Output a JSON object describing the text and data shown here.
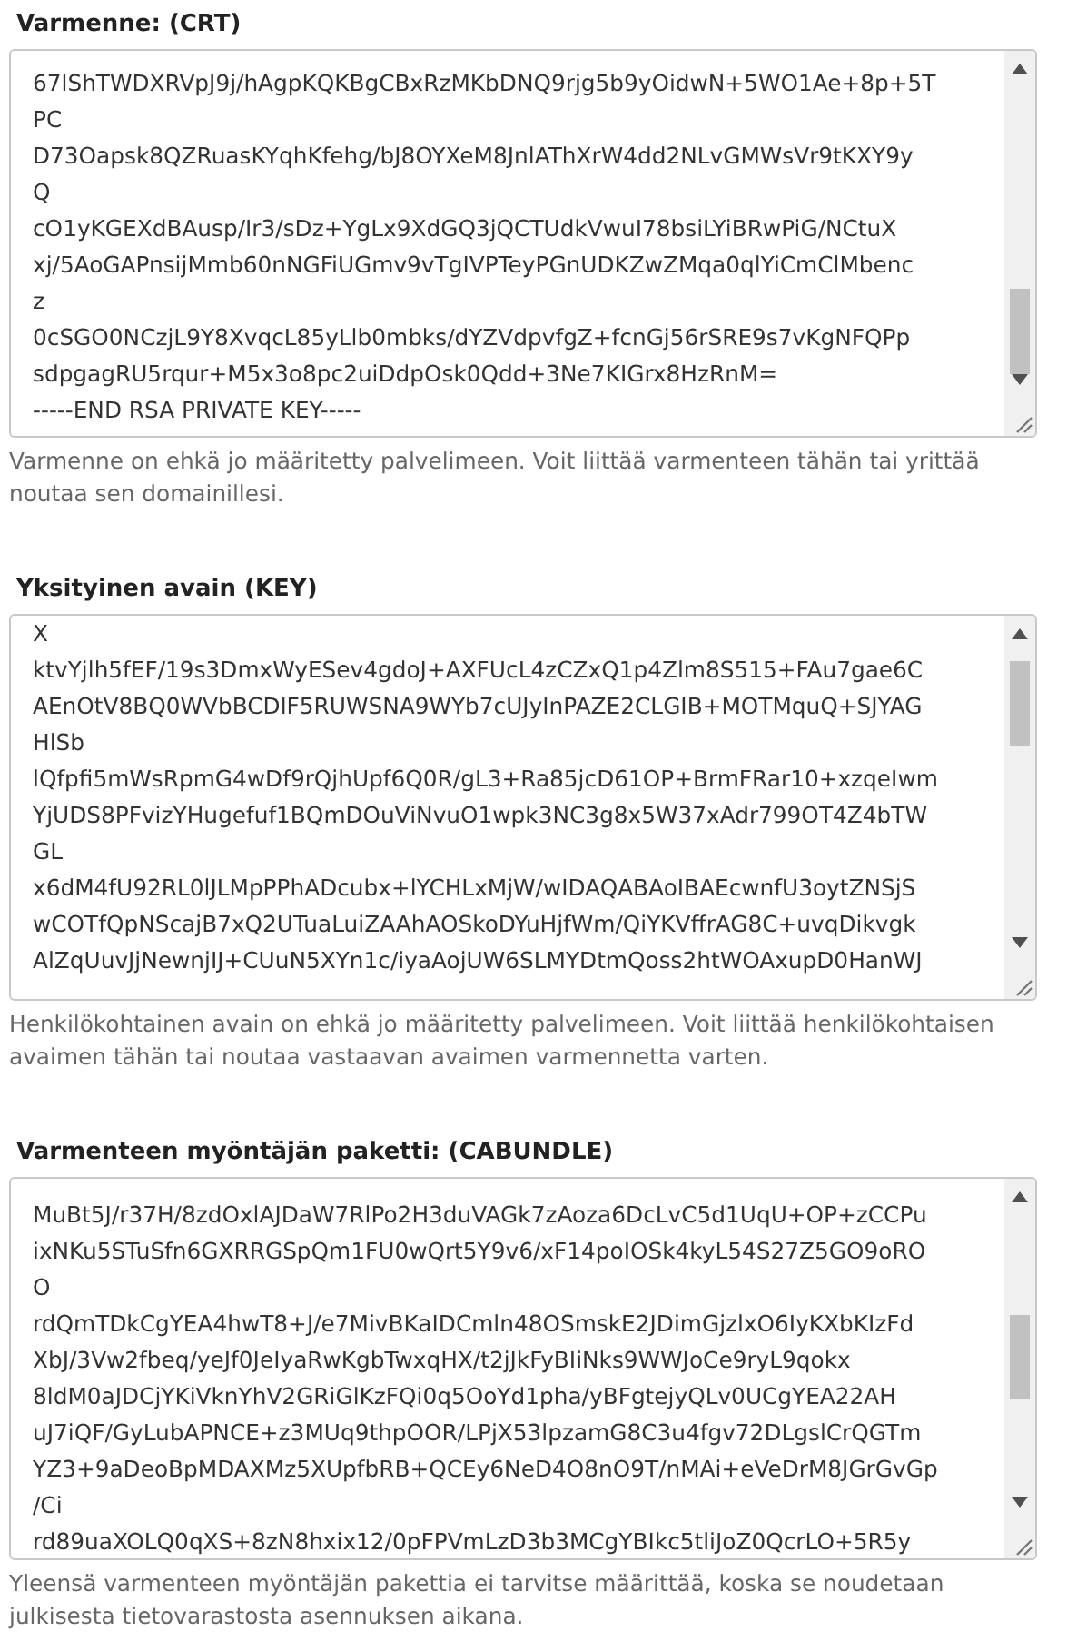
{
  "fields": [
    {
      "label": "Varmenne: (CRT)",
      "lines": [
        "67lShTWDXRVpJ9j/hAgpKQKBgCBxRzMKbDNQ9rjg5b9yOidwN+5WO1Ae+8p+5T",
        "PC",
        "D73Oapsk8QZRuasKYqhKfehg/bJ8OYXeM8JnlAThXrW4dd2NLvGMWsVr9tKXY9y",
        "Q",
        "cO1yKGEXdBAusp/Ir3/sDz+YgLx9XdGQ3jQCTUdkVwuI78bsiLYiBRwPiG/NCtuX",
        "xj/5AoGAPnsijMmb60nNGFiUGmv9vTgIVPTeyPGnUDKZwZMqa0qlYiCmClMbenc",
        "z",
        "0cSGO0NCzjL9Y8XvqcL85yLlb0mbks/dYZVdpvfgZ+fcnGj56rSRE9s7vKgNFQPp",
        "sdpgagRU5rqur+M5x3o8pc2uiDdpOsk0Qdd+3Ne7KIGrx8HzRnM=",
        "-----END RSA PRIVATE KEY-----"
      ],
      "help": "Varmenne on ehkä jo määritetty palvelimeen. Voit liittää varmenteen tähän tai yrittää noutaa sen domainillesi."
    },
    {
      "label": "Yksityinen avain (KEY)",
      "lines": [
        "X",
        "ktvYjlh5fEF/19s3DmxWyESev4gdoJ+AXFUcL4zCZxQ1p4Zlm8S515+FAu7gae6C",
        "AEnOtV8BQ0WVbBCDlF5RUWSNA9WYb7cUJyInPAZE2CLGIB+MOTMquQ+SJYAG",
        "HlSb",
        "lQfpfi5mWsRpmG4wDf9rQjhUpf6Q0R/gL3+Ra85jcD61OP+BrmFRar10+xzqeIwm",
        "YjUDS8PFvizYHugefuf1BQmDOuViNvuO1wpk3NC3g8x5W37xAdr799OT4Z4bTW",
        "GL",
        "x6dM4fU92RL0lJLMpPPhADcubx+lYCHLxMjW/wIDAQABAoIBAEcwnfU3oytZNSjS",
        "wCOTfQpNScajB7xQ2UTuaLuiZAAhAOSkoDYuHjfWm/QiYKVffrAG8C+uvqDikvgk",
        "AlZqUuvJjNewnjIJ+CUuN5XYn1c/iyaAojUW6SLMYDtmQoss2htWOAxupD0HanWJ"
      ],
      "help": "Henkilökohtainen avain on ehkä jo määritetty palvelimeen. Voit liittää henkilökohtaisen avaimen tähän tai noutaa vastaavan avaimen varmennetta varten."
    },
    {
      "label": "Varmenteen myöntäjän paketti: (CABUNDLE)",
      "lines": [
        "MuBt5J/r37H/8zdOxlAJDaW7RlPo2H3duVAGk7zAoza6DcLvC5d1UqU+OP+zCCPu",
        "ixNKu5STuSfn6GXRRGSpQm1FU0wQrt5Y9v6/xF14poIOSk4kyL54S27Z5GO9oRO",
        "O",
        "rdQmTDkCgYEA4hwT8+J/e7MivBKaIDCmln48OSmskE2JDimGjzlxO6IyKXbKIzFd",
        "XbJ/3Vw2fbeq/yeJf0JeIyaRwKgbTwxqHX/t2jJkFyBIiNks9WWJoCe9ryL9qokx",
        "8ldM0aJDCjYKiVknYhV2GRiGlKzFQi0q5OoYd1pha/yBFgtejyQLv0UCgYEA22AH",
        "uJ7iQF/GyLubAPNCE+z3MUq9thpOOR/LPjX53lpzamG8C3u4fgv72DLgslCrQGTm",
        "YZ3+9aDeoBpMDAXMz5XUpfbRB+QCEy6NeD4O8nO9T/nMAi+eVeDrM8JGrGvGp",
        "/Ci",
        "rd89uaXOLQ0qXS+8zN8hxix12/0pFPVmLzD3b3MCgYBIkc5tliJoZ0QcrLO+5R5y"
      ],
      "help": "Yleensä varmenteen myöntäjän pakettia ei tarvitse määrittää, koska se noudetaan julkisesta tietovarastosta asennuksen aikana."
    }
  ]
}
